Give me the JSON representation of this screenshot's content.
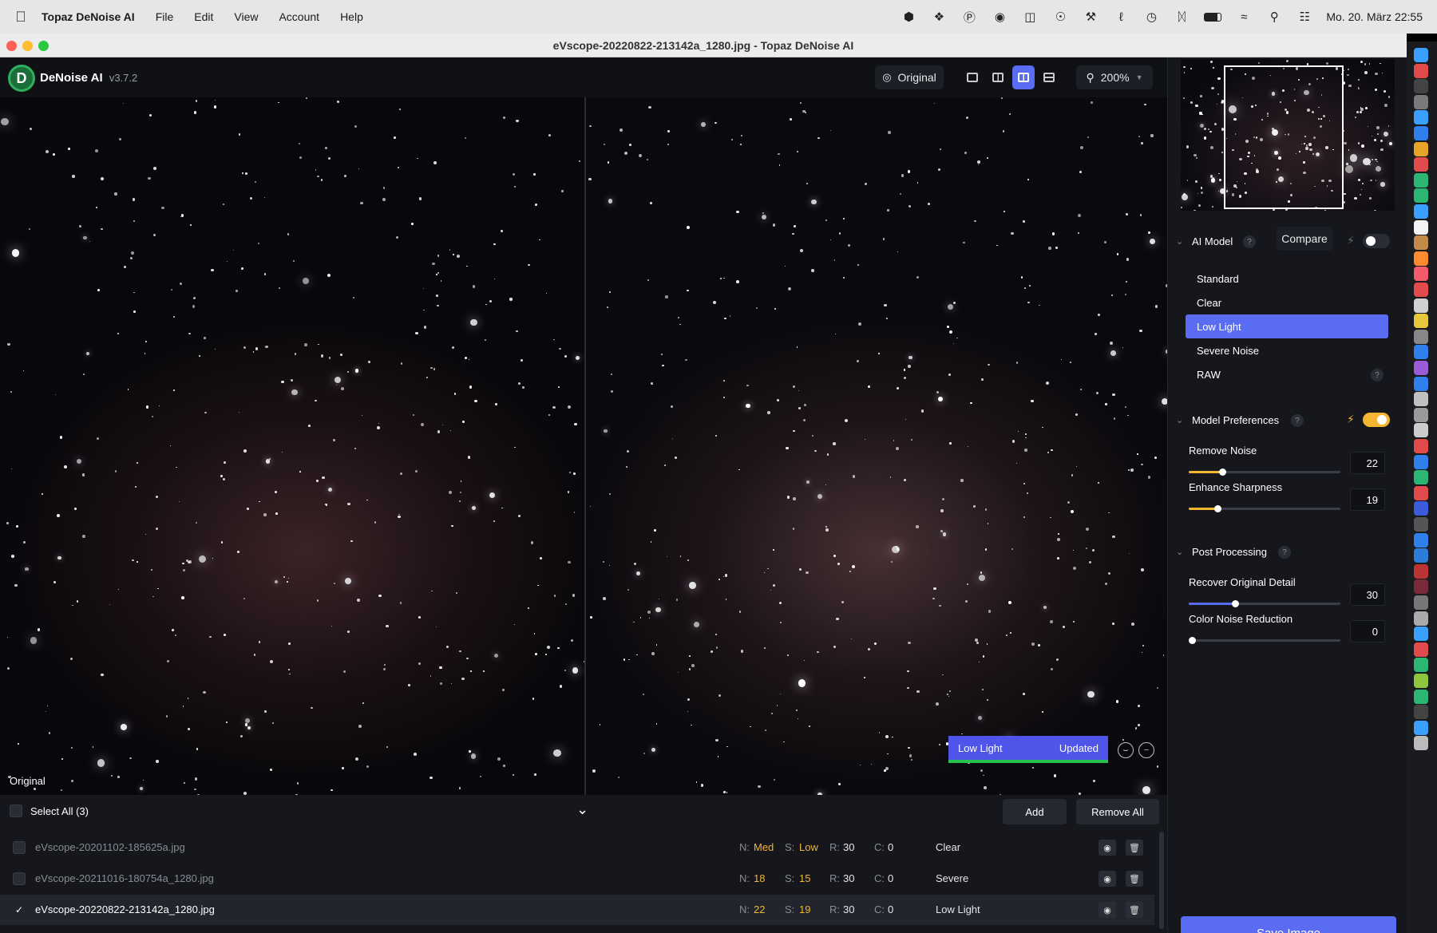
{
  "menubar": {
    "app_name": "Topaz DeNoise AI",
    "menus": [
      "File",
      "Edit",
      "View",
      "Account",
      "Help"
    ],
    "clock": "Mo. 20. März  22:55",
    "status_icons": [
      "shortcuts-icon",
      "dropbox-icon",
      "d-icon",
      "copilot-icon",
      "sidebar-icon",
      "1password-icon",
      "tools-icon",
      "sign-icon",
      "time-machine-icon",
      "bluetooth-icon",
      "battery-icon",
      "wifi-icon",
      "spotlight-icon",
      "control-center-icon"
    ]
  },
  "window": {
    "title": "eVscope-20220822-213142a_1280.jpg - Topaz DeNoise AI"
  },
  "toolbar": {
    "app_label": "DeNoise AI",
    "version": "v3.7.2",
    "original_button": "Original",
    "zoom": "200%",
    "view_modes": [
      "single-view",
      "split-view",
      "side-by-side-view",
      "comparison-view"
    ],
    "active_view": "side-by-side-view"
  },
  "preview": {
    "left_label": "Original",
    "status_model": "Low Light",
    "status_state": "Updated"
  },
  "filelist": {
    "select_all": "Select All (3)",
    "add_label": "Add",
    "remove_all_label": "Remove All",
    "labels": {
      "n": "N:",
      "s": "S:",
      "r": "R:",
      "c": "C:"
    },
    "rows": [
      {
        "name": "eVscope-20201102-185625a.jpg",
        "n": "Med",
        "s": "Low",
        "r": "30",
        "c": "0",
        "model": "Clear",
        "selected": false
      },
      {
        "name": "eVscope-20211016-180754a_1280.jpg",
        "n": "18",
        "s": "15",
        "r": "30",
        "c": "0",
        "model": "Severe",
        "selected": false
      },
      {
        "name": "eVscope-20220822-213142a_1280.jpg",
        "n": "22",
        "s": "19",
        "r": "30",
        "c": "0",
        "model": "Low Light",
        "selected": true
      }
    ]
  },
  "panel": {
    "ai_model_title": "AI Model",
    "compare_label": "Compare",
    "models": [
      "Standard",
      "Clear",
      "Low Light",
      "Severe Noise",
      "RAW"
    ],
    "active_model": "Low Light",
    "model_prefs_title": "Model Preferences",
    "remove_noise_label": "Remove Noise",
    "remove_noise_value": "22",
    "enhance_sharpness_label": "Enhance Sharpness",
    "enhance_sharpness_value": "19",
    "post_processing_title": "Post Processing",
    "recover_detail_label": "Recover Original Detail",
    "recover_detail_value": "30",
    "color_noise_label": "Color Noise Reduction",
    "color_noise_value": "0",
    "save_label": "Save Image",
    "help_glyph": "?"
  },
  "colors": {
    "accent": "#5a6cf2",
    "highlight": "#f2b632",
    "success": "#27c24c"
  }
}
